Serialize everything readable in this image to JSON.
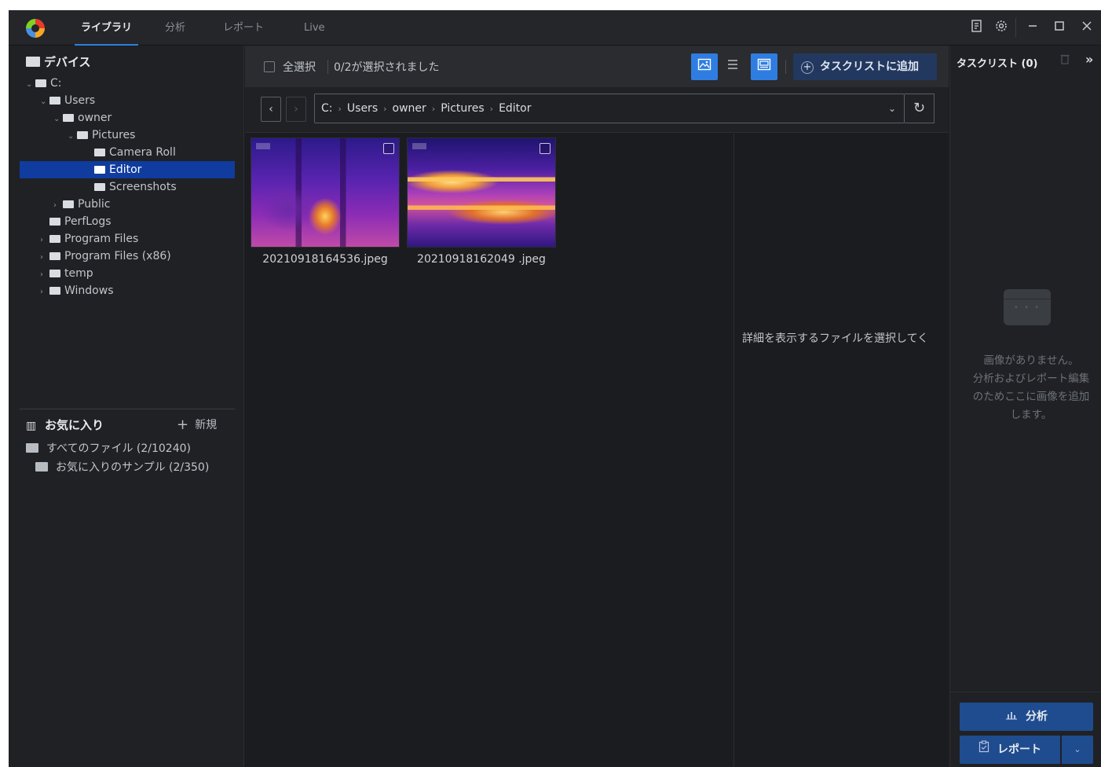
{
  "titlebar": {
    "tabs": [
      {
        "label": "ライブラリ",
        "active": true
      },
      {
        "label": "分析",
        "active": false
      },
      {
        "label": "レポート",
        "active": false
      },
      {
        "label": "Live",
        "active": false
      }
    ],
    "icons": [
      "notes-icon",
      "gear-icon",
      "minimize-icon",
      "maximize-icon",
      "close-icon"
    ]
  },
  "devices": {
    "title": "デバイス",
    "tree": [
      {
        "label": "C:",
        "chevron": "⌄"
      },
      {
        "label": "Users",
        "chevron": "⌄"
      },
      {
        "label": "owner",
        "chevron": "⌄"
      },
      {
        "label": "Pictures",
        "chevron": "⌄"
      },
      {
        "label": "Camera Roll",
        "chevron": ""
      },
      {
        "label": "Editor",
        "chevron": "",
        "selected": true
      },
      {
        "label": "Screenshots",
        "chevron": ""
      },
      {
        "label": "Public",
        "chevron": "›"
      },
      {
        "label": "PerfLogs",
        "chevron": ""
      },
      {
        "label": "Program Files",
        "chevron": "›"
      },
      {
        "label": "Program Files (x86)",
        "chevron": "›"
      },
      {
        "label": "temp",
        "chevron": "›"
      },
      {
        "label": "Windows",
        "chevron": "›"
      }
    ]
  },
  "favorites": {
    "title": "お気に入り",
    "new_label": "新規",
    "items": [
      {
        "label": "すべてのファイル (2/10240)"
      },
      {
        "label": "お気に入りのサンプル (2/350)"
      }
    ]
  },
  "toolbar": {
    "select_all": "全選択",
    "selected_count": "0/2が選択されました",
    "add_to_tasklist": "タスクリストに追加"
  },
  "path": {
    "crumbs": [
      "C:",
      "Users",
      "owner",
      "Pictures",
      "Editor"
    ]
  },
  "files": [
    {
      "name": "20210918164536.jpeg"
    },
    {
      "name": "20210918162049 .jpeg"
    }
  ],
  "details": {
    "message": "詳細を表示するファイルを選択してく"
  },
  "tasklist": {
    "title": "タスクリスト (0)",
    "empty_lines": [
      "画像がありません。",
      "分析およびレポート編集",
      "のためここに画像を追加",
      "します。"
    ],
    "analyze_label": "分析",
    "report_label": "レポート"
  },
  "colors": {
    "accent": "#2f7de1",
    "selection": "#0f3c9e",
    "button": "#1f4c8f"
  }
}
